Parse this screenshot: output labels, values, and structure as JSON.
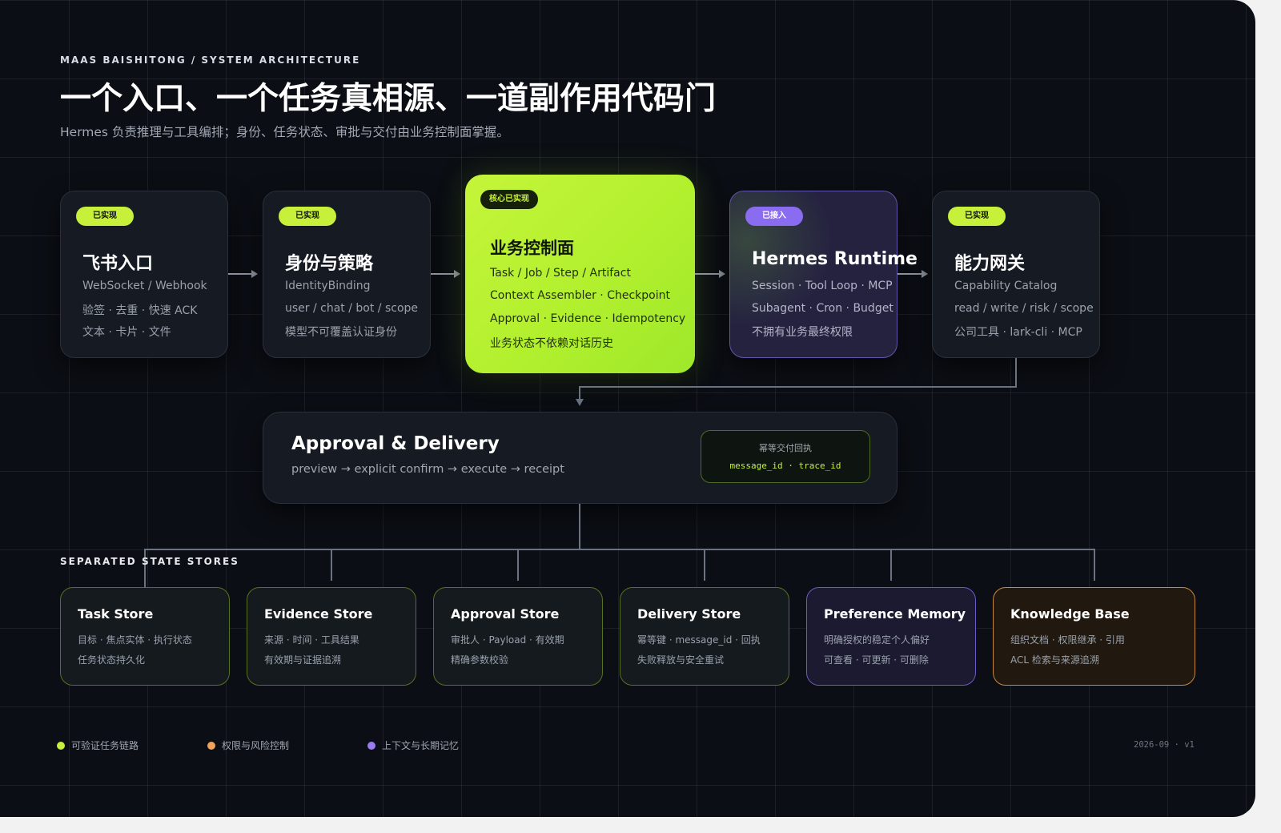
{
  "header": {
    "eyebrow": "MAAS BAISHITONG / SYSTEM ARCHITECTURE",
    "title": "一个入口、一个任务真相源、一道副作用代码门",
    "subtitle": "Hermes 负责推理与工具编排；身份、任务状态、审批与交付由业务控制面掌握。"
  },
  "pipeline": [
    {
      "badge": "已实现",
      "title": "飞书入口",
      "lines": [
        "WebSocket / Webhook",
        "验签 · 去重 · 快速 ACK",
        "文本 · 卡片 · 文件"
      ]
    },
    {
      "badge": "已实现",
      "title": "身份与策略",
      "lines": [
        "IdentityBinding",
        "user / chat / bot / scope",
        "模型不可覆盖认证身份"
      ]
    },
    {
      "badge": "核心已实现",
      "title": "业务控制面",
      "lines": [
        "Task / Job / Step / Artifact",
        "Context Assembler · Checkpoint",
        "Approval · Evidence · Idempotency",
        "业务状态不依赖对话历史"
      ]
    },
    {
      "badge": "已接入",
      "title": "Hermes Runtime",
      "lines": [
        "Session · Tool Loop · MCP",
        "Subagent · Cron · Budget",
        "不拥有业务最终权限"
      ]
    },
    {
      "badge": "已实现",
      "title": "能力网关",
      "lines": [
        "Capability Catalog",
        "read / write / risk / scope",
        "公司工具 · lark-cli · MCP"
      ]
    }
  ],
  "approval": {
    "title": "Approval & Delivery",
    "flow": "preview → explicit confirm → execute → receipt",
    "receipt_label": "幂等交付回执",
    "receipt_ids": "message_id · trace_id"
  },
  "stores_section": "SEPARATED STATE STORES",
  "stores": [
    {
      "title": "Task Store",
      "lines": [
        "目标 · 焦点实体 · 执行状态",
        "任务状态持久化"
      ]
    },
    {
      "title": "Evidence Store",
      "lines": [
        "来源 · 时间 · 工具结果",
        "有效期与证据追溯"
      ]
    },
    {
      "title": "Approval Store",
      "lines": [
        "审批人 · Payload · 有效期",
        "精确参数校验"
      ]
    },
    {
      "title": "Delivery Store",
      "lines": [
        "幂等键 · message_id · 回执",
        "失败释放与安全重试"
      ]
    },
    {
      "title": "Preference Memory",
      "lines": [
        "明确授权的稳定个人偏好",
        "可查看 · 可更新 · 可删除"
      ]
    },
    {
      "title": "Knowledge Base",
      "lines": [
        "组织文档 · 权限继承 · 引用",
        "ACL 检索与来源追溯"
      ]
    }
  ],
  "legend": [
    {
      "label": "可验证任务链路",
      "color": "#c6f03a"
    },
    {
      "label": "权限与风险控制",
      "color": "#f0a45a"
    },
    {
      "label": "上下文与长期记忆",
      "color": "#9a7cf2"
    }
  ],
  "version": "2026-09 · v1",
  "colors": {
    "accent": "#c6f03a",
    "runtime": "#8a6cf0",
    "knowledge": "#c58a3c",
    "background": "#0b0e14"
  }
}
